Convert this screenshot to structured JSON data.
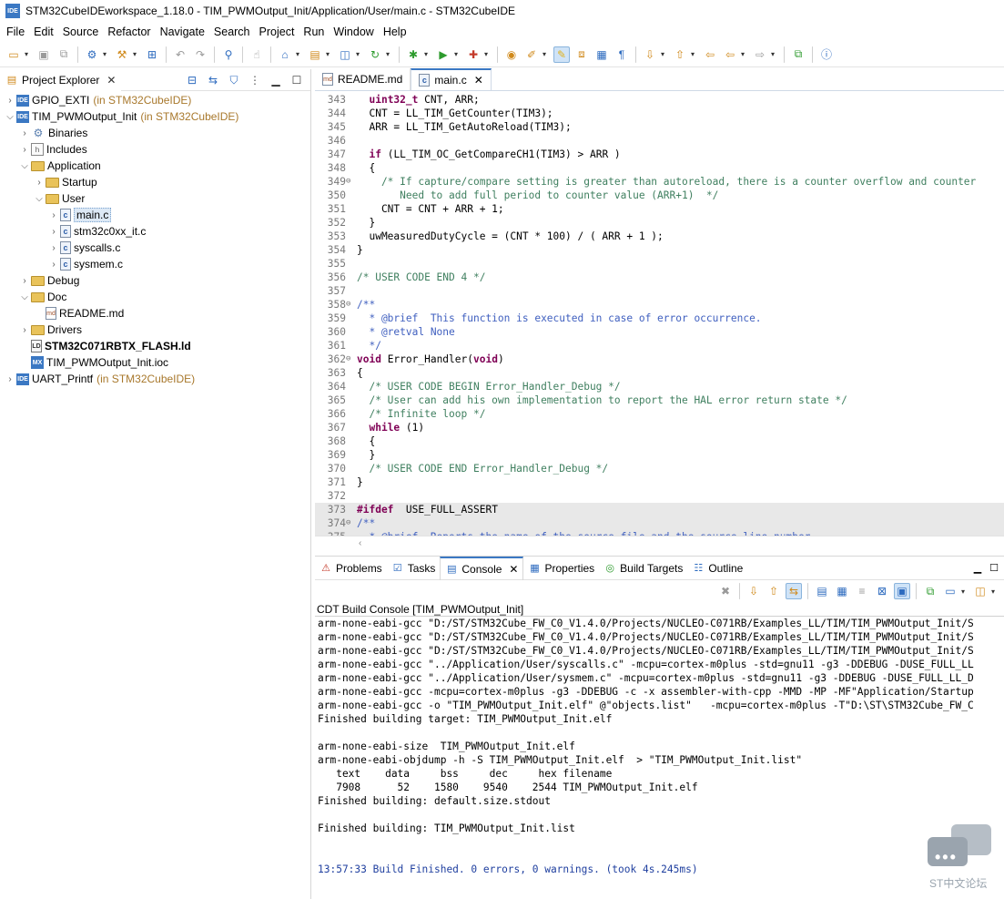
{
  "window": {
    "title": "STM32CubeIDEworkspace_1.18.0 - TIM_PWMOutput_Init/Application/User/main.c - STM32CubeIDE",
    "app_icon_text": "IDE"
  },
  "menu": [
    "File",
    "Edit",
    "Source",
    "Refactor",
    "Navigate",
    "Search",
    "Project",
    "Run",
    "Window",
    "Help"
  ],
  "explorer": {
    "tab_label": "Project Explorer",
    "tree": [
      {
        "label": "GPIO_EXTI",
        "decor": "(in STM32CubeIDE)",
        "indent": 0,
        "arrow": "›",
        "icon": "proj"
      },
      {
        "label": "TIM_PWMOutput_Init",
        "decor": "(in STM32CubeIDE)",
        "indent": 0,
        "arrow": "⌄",
        "icon": "proj"
      },
      {
        "label": "Binaries",
        "decor": "",
        "indent": 1,
        "arrow": "›",
        "icon": "gear"
      },
      {
        "label": "Includes",
        "decor": "",
        "indent": 1,
        "arrow": "›",
        "icon": "inc"
      },
      {
        "label": "Application",
        "decor": "",
        "indent": 1,
        "arrow": "⌄",
        "icon": "folder"
      },
      {
        "label": "Startup",
        "decor": "",
        "indent": 2,
        "arrow": "›",
        "icon": "folder"
      },
      {
        "label": "User",
        "decor": "",
        "indent": 2,
        "arrow": "⌄",
        "icon": "folder"
      },
      {
        "label": "main.c",
        "decor": "",
        "indent": 3,
        "arrow": "›",
        "icon": "cfile",
        "selected": true
      },
      {
        "label": "stm32c0xx_it.c",
        "decor": "",
        "indent": 3,
        "arrow": "›",
        "icon": "cfile"
      },
      {
        "label": "syscalls.c",
        "decor": "",
        "indent": 3,
        "arrow": "›",
        "icon": "cfile"
      },
      {
        "label": "sysmem.c",
        "decor": "",
        "indent": 3,
        "arrow": "›",
        "icon": "cfile"
      },
      {
        "label": "Debug",
        "decor": "",
        "indent": 1,
        "arrow": "›",
        "icon": "folder"
      },
      {
        "label": "Doc",
        "decor": "",
        "indent": 1,
        "arrow": "⌄",
        "icon": "folder"
      },
      {
        "label": "README.md",
        "decor": "",
        "indent": 2,
        "arrow": "",
        "icon": "md"
      },
      {
        "label": "Drivers",
        "decor": "",
        "indent": 1,
        "arrow": "›",
        "icon": "folder"
      },
      {
        "label": "STM32C071RBTX_FLASH.ld",
        "decor": "",
        "indent": 1,
        "arrow": "",
        "icon": "ld",
        "bold": true
      },
      {
        "label": "TIM_PWMOutput_Init.ioc",
        "decor": "",
        "indent": 1,
        "arrow": "",
        "icon": "ioc"
      },
      {
        "label": "UART_Printf",
        "decor": "(in STM32CubeIDE)",
        "indent": 0,
        "arrow": "›",
        "icon": "proj"
      }
    ]
  },
  "editor": {
    "tabs": [
      {
        "label": "README.md",
        "active": false,
        "icon": "md"
      },
      {
        "label": "main.c",
        "active": true,
        "icon": "cfile"
      }
    ],
    "lines": [
      {
        "n": "343",
        "fold": "",
        "text": "  uint32_t CNT, ARR;",
        "type": "code"
      },
      {
        "n": "344",
        "fold": "",
        "text": "  CNT = LL_TIM_GetCounter(TIM3);",
        "type": "code"
      },
      {
        "n": "345",
        "fold": "",
        "text": "  ARR = LL_TIM_GetAutoReload(TIM3);",
        "type": "code"
      },
      {
        "n": "346",
        "fold": "",
        "text": "",
        "type": "code"
      },
      {
        "n": "347",
        "fold": "",
        "text": "  if (LL_TIM_OC_GetCompareCH1(TIM3) > ARR )",
        "type": "if"
      },
      {
        "n": "348",
        "fold": "",
        "text": "  {",
        "type": "code"
      },
      {
        "n": "349",
        "fold": "⊖",
        "text": "    /* If capture/compare setting is greater than autoreload, there is a counter overflow and counter",
        "type": "comment"
      },
      {
        "n": "350",
        "fold": "",
        "text": "       Need to add full period to counter value (ARR+1)  */",
        "type": "comment"
      },
      {
        "n": "351",
        "fold": "",
        "text": "    CNT = CNT + ARR + 1;",
        "type": "code"
      },
      {
        "n": "352",
        "fold": "",
        "text": "  }",
        "type": "code"
      },
      {
        "n": "353",
        "fold": "",
        "text": "  uwMeasuredDutyCycle = (CNT * 100) / ( ARR + 1 );",
        "type": "code"
      },
      {
        "n": "354",
        "fold": "",
        "text": "}",
        "type": "code"
      },
      {
        "n": "355",
        "fold": "",
        "text": "",
        "type": "code"
      },
      {
        "n": "356",
        "fold": "",
        "text": "/* USER CODE END 4 */",
        "type": "comment"
      },
      {
        "n": "357",
        "fold": "",
        "text": "",
        "type": "code"
      },
      {
        "n": "358",
        "fold": "⊖",
        "text": "/**",
        "type": "doc"
      },
      {
        "n": "359",
        "fold": "",
        "text": "  * @brief  This function is executed in case of error occurrence.",
        "type": "doc"
      },
      {
        "n": "360",
        "fold": "",
        "text": "  * @retval None",
        "type": "doc"
      },
      {
        "n": "361",
        "fold": "",
        "text": "  */",
        "type": "doc"
      },
      {
        "n": "362",
        "fold": "⊖",
        "text": "void Error_Handler(void)",
        "type": "void"
      },
      {
        "n": "363",
        "fold": "",
        "text": "{",
        "type": "code"
      },
      {
        "n": "364",
        "fold": "",
        "text": "  /* USER CODE BEGIN Error_Handler_Debug */",
        "type": "comment"
      },
      {
        "n": "365",
        "fold": "",
        "text": "  /* User can add his own implementation to report the HAL error return state */",
        "type": "comment"
      },
      {
        "n": "366",
        "fold": "",
        "text": "  /* Infinite loop */",
        "type": "comment"
      },
      {
        "n": "367",
        "fold": "",
        "text": "  while (1)",
        "type": "while"
      },
      {
        "n": "368",
        "fold": "",
        "text": "  {",
        "type": "code"
      },
      {
        "n": "369",
        "fold": "",
        "text": "  }",
        "type": "code"
      },
      {
        "n": "370",
        "fold": "",
        "text": "  /* USER CODE END Error_Handler_Debug */",
        "type": "comment"
      },
      {
        "n": "371",
        "fold": "",
        "text": "}",
        "type": "code"
      },
      {
        "n": "372",
        "fold": "",
        "text": "",
        "type": "code"
      },
      {
        "n": "373",
        "fold": "",
        "text": "#ifdef  USE_FULL_ASSERT",
        "type": "ifdef",
        "hl": true
      },
      {
        "n": "374",
        "fold": "⊖",
        "text": "/**",
        "type": "doc",
        "hl": true
      },
      {
        "n": "375",
        "fold": "",
        "text": "  * @brief  Reports the name of the source file and the source line number",
        "type": "doc",
        "hl": true
      }
    ]
  },
  "bottom": {
    "tabs": [
      {
        "label": "Problems",
        "icon": "problems",
        "active": false
      },
      {
        "label": "Tasks",
        "icon": "tasks",
        "active": false
      },
      {
        "label": "Console",
        "icon": "console",
        "active": true
      },
      {
        "label": "Properties",
        "icon": "properties",
        "active": false
      },
      {
        "label": "Build Targets",
        "icon": "target",
        "active": false
      },
      {
        "label": "Outline",
        "icon": "outline",
        "active": false
      }
    ],
    "console_label": "CDT Build Console [TIM_PWMOutput_Init]",
    "console_lines": [
      {
        "text": "arm-none-eabi-gcc \"D:/ST/STM32Cube_FW_C0_V1.4.0/Projects/NUCLEO-C071RB/Examples_LL/TIM/TIM_PWMOutput_Init/S",
        "type": "out"
      },
      {
        "text": "arm-none-eabi-gcc \"D:/ST/STM32Cube_FW_C0_V1.4.0/Projects/NUCLEO-C071RB/Examples_LL/TIM/TIM_PWMOutput_Init/S",
        "type": "out"
      },
      {
        "text": "arm-none-eabi-gcc \"D:/ST/STM32Cube_FW_C0_V1.4.0/Projects/NUCLEO-C071RB/Examples_LL/TIM/TIM_PWMOutput_Init/S",
        "type": "out"
      },
      {
        "text": "arm-none-eabi-gcc \"../Application/User/syscalls.c\" -mcpu=cortex-m0plus -std=gnu11 -g3 -DDEBUG -DUSE_FULL_LL",
        "type": "out"
      },
      {
        "text": "arm-none-eabi-gcc \"../Application/User/sysmem.c\" -mcpu=cortex-m0plus -std=gnu11 -g3 -DDEBUG -DUSE_FULL_LL_D",
        "type": "out"
      },
      {
        "text": "arm-none-eabi-gcc -mcpu=cortex-m0plus -g3 -DDEBUG -c -x assembler-with-cpp -MMD -MP -MF\"Application/Startup",
        "type": "out"
      },
      {
        "text": "arm-none-eabi-gcc -o \"TIM_PWMOutput_Init.elf\" @\"objects.list\"   -mcpu=cortex-m0plus -T\"D:\\ST\\STM32Cube_FW_C",
        "type": "out"
      },
      {
        "text": "Finished building target: TIM_PWMOutput_Init.elf",
        "type": "out"
      },
      {
        "text": "",
        "type": "out"
      },
      {
        "text": "arm-none-eabi-size  TIM_PWMOutput_Init.elf",
        "type": "out"
      },
      {
        "text": "arm-none-eabi-objdump -h -S TIM_PWMOutput_Init.elf  > \"TIM_PWMOutput_Init.list\"",
        "type": "out"
      },
      {
        "text": "   text    data     bss     dec     hex filename",
        "type": "out"
      },
      {
        "text": "   7908      52    1580    9540    2544 TIM_PWMOutput_Init.elf",
        "type": "out"
      },
      {
        "text": "Finished building: default.size.stdout",
        "type": "out"
      },
      {
        "text": "",
        "type": "out"
      },
      {
        "text": "Finished building: TIM_PWMOutput_Init.list",
        "type": "out"
      },
      {
        "text": "",
        "type": "out"
      },
      {
        "text": "",
        "type": "out"
      },
      {
        "text": "13:57:33 Build Finished. 0 errors, 0 warnings. (took 4s.245ms)",
        "type": "finish"
      }
    ]
  },
  "watermark": {
    "text": "ST中文论坛"
  }
}
